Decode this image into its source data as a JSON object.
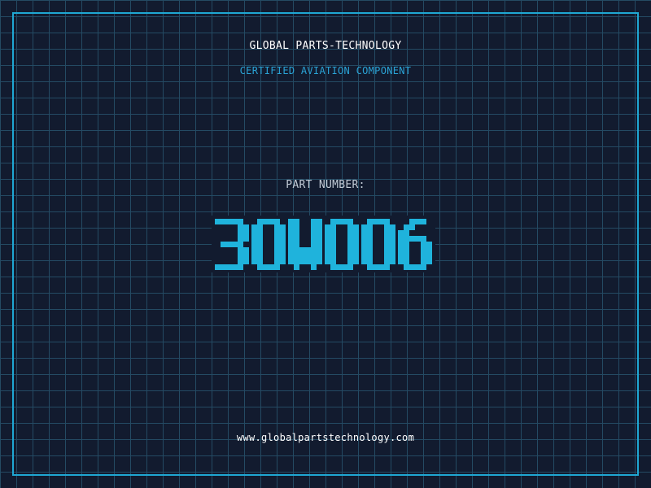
{
  "header": {
    "company": "GLOBAL PARTS-TECHNOLOGY",
    "tagline": "CERTIFIED AVIATION COMPONENT"
  },
  "part": {
    "label": "PART NUMBER:",
    "number": "30W006"
  },
  "footer": {
    "url": "www.globalpartstechnology.com"
  },
  "colors": {
    "background": "#121b2f",
    "grid": "#244a63",
    "frame": "#1fa7d3",
    "accent": "#1fb3dc",
    "text": "#ffffff",
    "muted": "#c3ccd7"
  }
}
